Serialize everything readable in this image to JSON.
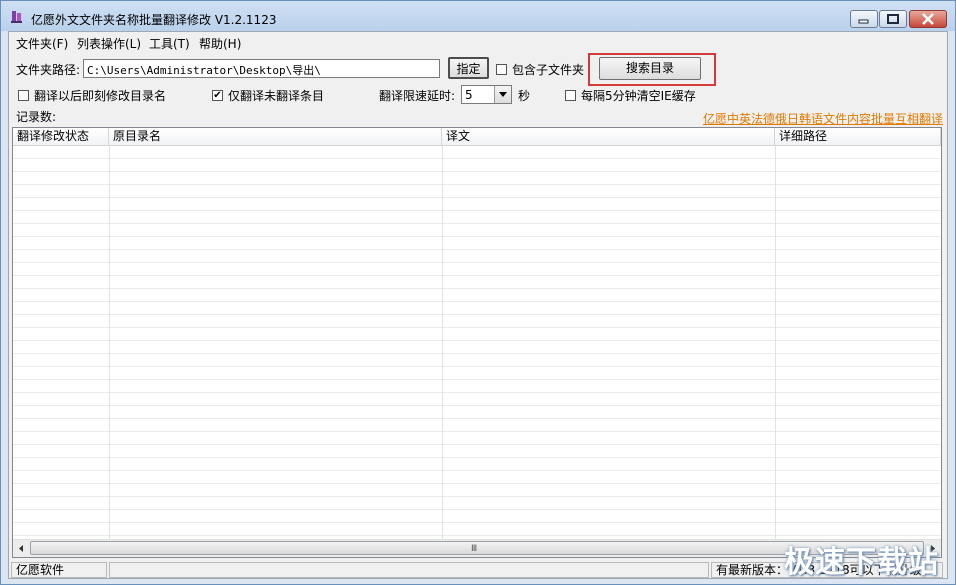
{
  "window": {
    "title": "亿愿外文文件夹名称批量翻译修改 V1.2.1123"
  },
  "menu": [
    {
      "label": "文件夹(F)"
    },
    {
      "label": "列表操作(L)"
    },
    {
      "label": "工具(T)"
    },
    {
      "label": "帮助(H)"
    }
  ],
  "path": {
    "label": "文件夹路径:",
    "value": "C:\\Users\\Administrator\\Desktop\\导出\\",
    "browse_button": "指定",
    "include_sub_label": "包含子文件夹",
    "include_sub_checked": false,
    "search_button": "搜索目录"
  },
  "options": {
    "rename_after_label": "翻译以后即刻修改目录名",
    "rename_after_checked": false,
    "only_untranslated_label": "仅翻译未翻译条目",
    "only_untranslated_checked": true,
    "delay_label": "翻译限速延时:",
    "delay_value": "5",
    "delay_unit": "秒",
    "clear_cache_label": "每隔5分钟清空IE缓存",
    "clear_cache_checked": false
  },
  "records": {
    "label": "记录数:"
  },
  "promo_link": "亿愿中英法德俄日韩语文件内容批量互相翻译",
  "table": {
    "columns": [
      "翻译修改状态",
      "原目录名",
      "译文",
      "详细路径"
    ]
  },
  "status": {
    "left": "亿愿软件",
    "middle": "",
    "right": "有最新版本：V1.3.1218可以下载升级。"
  },
  "watermark": "极速下载站",
  "icons": {
    "checked_mark": "✔",
    "grip": "Ⅲ"
  }
}
